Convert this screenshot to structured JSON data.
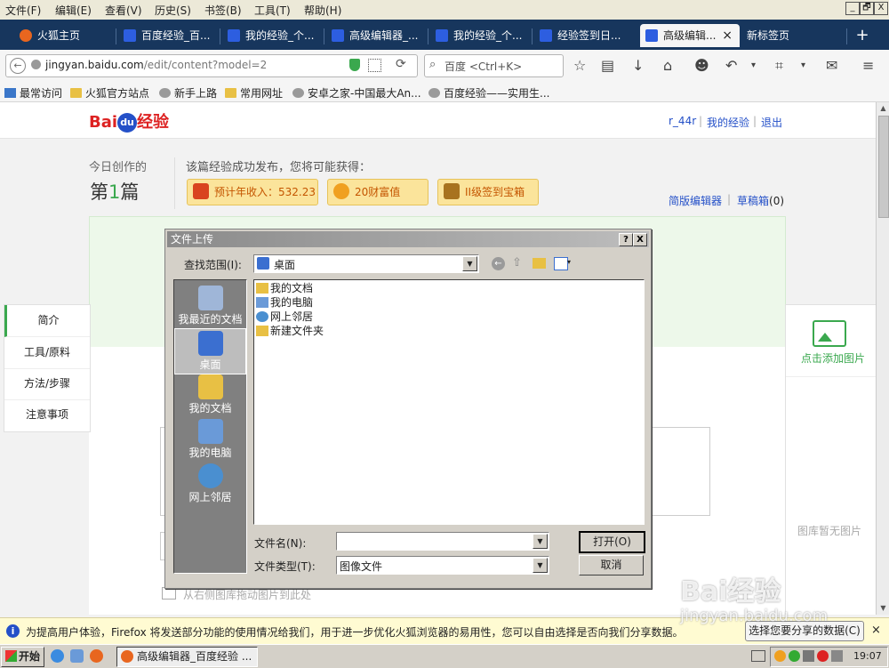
{
  "menubar": {
    "items": [
      "文件(F)",
      "编辑(E)",
      "查看(V)",
      "历史(S)",
      "书签(B)",
      "工具(T)",
      "帮助(H)"
    ],
    "window_buttons": [
      "_",
      "🗗",
      "X"
    ]
  },
  "tabs": [
    {
      "label": "火狐主页"
    },
    {
      "label": "百度经验_百..."
    },
    {
      "label": "我的经验_个..."
    },
    {
      "label": "高级编辑器_..."
    },
    {
      "label": "我的经验_个..."
    },
    {
      "label": "经验签到日..."
    },
    {
      "label": "高级编辑...",
      "active": true,
      "close": "×"
    },
    {
      "label": "新标签页"
    }
  ],
  "new_tab": "+",
  "nav": {
    "url": "jingyan.baidu.com/edit/content?model=2",
    "url_domain": "jingyan.baidu.com",
    "url_path": "/edit/content?model=2",
    "search_placeholder": "百度 <Ctrl+K>"
  },
  "bookmarks": [
    "最常访问",
    "火狐官方站点",
    "新手上路",
    "常用网址",
    "安卓之家-中国最大An...",
    "百度经验——实用生..."
  ],
  "site": {
    "logo_bai": "Bai",
    "logo_paw": "du",
    "logo_suffix": "经验",
    "user": "r_44r",
    "my_jingyan": "我的经验",
    "logout": "退出",
    "today_label": "今日创作的",
    "count_prefix": "第",
    "count_num": "1",
    "count_suffix": "篇",
    "published_msg": "该篇经验成功发布，您将可能获得：",
    "award_income": "预计年收入：532.23",
    "award_wealth": "20财富值",
    "award_box": "II级签到宝箱",
    "simple_editor": "简版编辑器",
    "drafts": "草稿箱",
    "drafts_count": "(0)",
    "left_nav": [
      "简介",
      "工具/原料",
      "方法/步骤",
      "注意事项"
    ],
    "add_image": "点击添加图片",
    "no_image": "图库暂无图片",
    "drag_hint": "从右侧图库拖动图片到此处"
  },
  "dialog": {
    "title": "文件上传",
    "help_btn": "?",
    "close_btn": "X",
    "look_in_label": "查找范围(I):",
    "look_in_value": "桌面",
    "places": [
      {
        "label": "我最近的文档"
      },
      {
        "label": "桌面",
        "selected": true
      },
      {
        "label": "我的文档"
      },
      {
        "label": "我的电脑"
      },
      {
        "label": "网上邻居"
      }
    ],
    "files": [
      "我的文档",
      "我的电脑",
      "网上邻居",
      "新建文件夹"
    ],
    "filename_label": "文件名(N):",
    "filename_value": "",
    "filetype_label": "文件类型(T):",
    "filetype_value": "图像文件",
    "open_btn": "打开(O)",
    "cancel_btn": "取消"
  },
  "notice": {
    "text": "为提高用户体验，Firefox 将发送部分功能的使用情况给我们，用于进一步优化火狐浏览器的易用性，您可以自由选择是否向我们分享数据。",
    "button": "选择您要分享的数据(C)"
  },
  "taskbar": {
    "start": "开始",
    "app": "高级编辑器_百度经验 ...",
    "clock": "19:07"
  },
  "watermark": {
    "brand": "Bai经验",
    "url": "jingyan.baidu.com"
  },
  "colors": {
    "tabbar": "#17365d",
    "link": "#2450c8",
    "award_bg": "#fbe49b",
    "green_accent": "#3aa84e",
    "dialog_face": "#d4d0c8"
  }
}
